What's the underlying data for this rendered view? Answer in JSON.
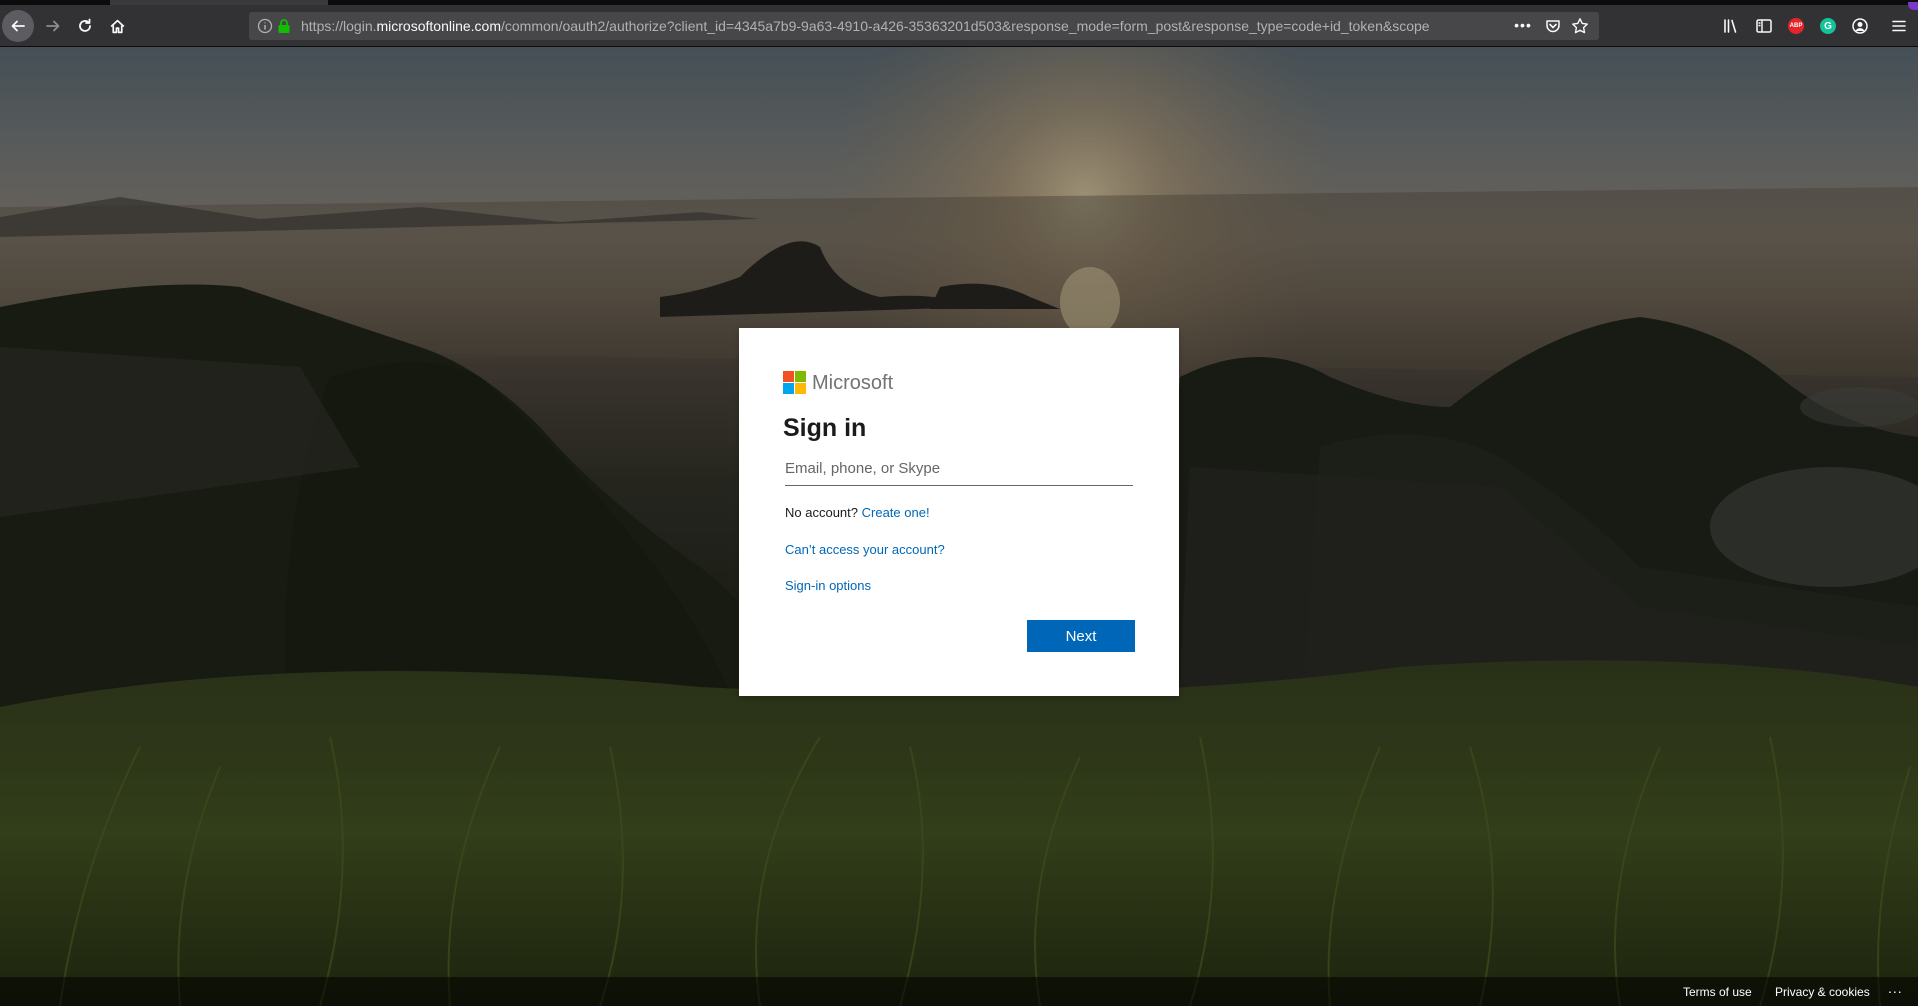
{
  "browser": {
    "url_prefix": "https://login.",
    "url_host": "microsoftonline.com",
    "url_path": "/common/oauth2/authorize?client_id=4345a7b9-9a63-4910-a426-35363201d503&response_mode=form_post&response_type=code+id_token&scope",
    "url_more": "•••",
    "extensions": {
      "adblock_label": "ABP",
      "grammarly_label": "G"
    },
    "colors": {
      "toolbar": "#323234",
      "urlbar": "#474749",
      "lock": "#12bc00"
    }
  },
  "signin": {
    "brand": "Microsoft",
    "title": "Sign in",
    "email_placeholder": "Email, phone, or Skype",
    "email_value": "",
    "no_account_text": "No account?",
    "create_link": "Create one!",
    "cant_access_link": "Can’t access your account?",
    "signin_options_link": "Sign-in options",
    "next_label": "Next",
    "colors": {
      "accent": "#0067b8",
      "logo_red": "#f25022",
      "logo_green": "#7fba00",
      "logo_blue": "#00a4ef",
      "logo_yellow": "#ffb900"
    }
  },
  "footer": {
    "terms": "Terms of use",
    "privacy": "Privacy & cookies",
    "more": "..."
  }
}
